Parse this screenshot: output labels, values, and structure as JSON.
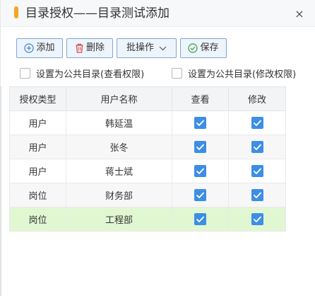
{
  "dialog": {
    "title": "目录授权——目录测试添加",
    "close_label": "×"
  },
  "toolbar": {
    "add_label": "添加",
    "delete_label": "删除",
    "batch_label": "批操作",
    "save_label": "保存"
  },
  "options": {
    "public_view_label": "设置为公共目录(查看权限)",
    "public_edit_label": "设置为公共目录(修改权限)",
    "public_view_checked": false,
    "public_edit_checked": false
  },
  "table": {
    "headers": [
      "授权类型",
      "用户名称",
      "查看",
      "修改"
    ],
    "rows": [
      {
        "type": "用户",
        "name": "韩延温",
        "view": true,
        "edit": true
      },
      {
        "type": "用户",
        "name": "张冬",
        "view": true,
        "edit": true
      },
      {
        "type": "用户",
        "name": "蒋士斌",
        "view": true,
        "edit": true
      },
      {
        "type": "岗位",
        "name": "财务部",
        "view": true,
        "edit": true
      },
      {
        "type": "岗位",
        "name": "工程部",
        "view": true,
        "edit": true
      }
    ],
    "selected_row": 4
  },
  "colors": {
    "accent": "#f5a623",
    "checkbox": "#3d8ee6",
    "selected_row": "#e1f7d2",
    "button_border": "#7fa7d4"
  }
}
